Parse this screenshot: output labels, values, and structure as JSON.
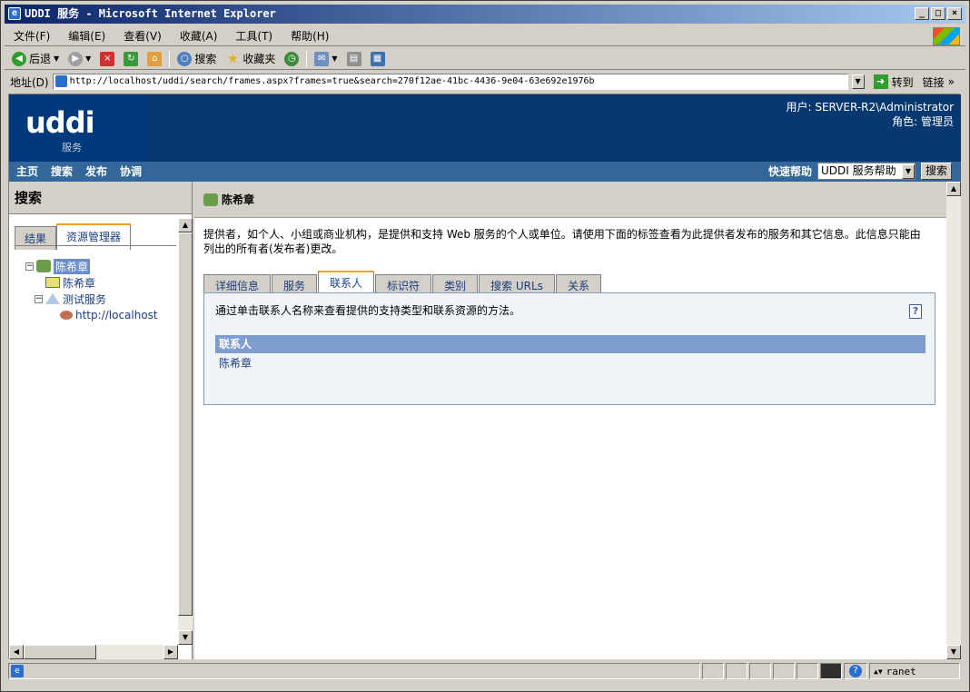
{
  "window": {
    "title": "UDDI 服务 - Microsoft Internet Explorer",
    "min_label": "_",
    "max_label": "□",
    "close_label": "×"
  },
  "menu": [
    "文件(F)",
    "编辑(E)",
    "查看(V)",
    "收藏(A)",
    "工具(T)",
    "帮助(H)"
  ],
  "toolbar": {
    "back_label": "后退",
    "search_label": "搜索",
    "favorites_label": "收藏夹"
  },
  "address": {
    "label": "地址(D)",
    "url": "http://localhost/uddi/search/frames.aspx?frames=true&search=270f12ae-41bc-4436-9e04-63e692e1976b",
    "go_label": "转到",
    "links_label": "链接"
  },
  "header": {
    "logo_main": "uddi",
    "logo_sub": "服务",
    "user_line": "用户: SERVER-R2\\Administrator",
    "role_line": "角色: 管理员"
  },
  "nav": {
    "items": [
      "主页",
      "搜索",
      "发布",
      "协调"
    ],
    "quick_help_label": "快速帮助",
    "quick_help_value": "UDDI 服务帮助",
    "search_button": "搜索"
  },
  "left": {
    "title": "搜索",
    "tabs": [
      "结果",
      "资源管理器"
    ],
    "tree": {
      "root": "陈希章",
      "child1": "陈希章",
      "child2": "测试服务",
      "child2_leaf": "http://localhost"
    }
  },
  "right": {
    "title": "陈希章",
    "description": "提供者，如个人、小组或商业机构，是提供和支持 Web 服务的个人或单位。请使用下面的标签查看为此提供者发布的服务和其它信息。此信息只能由列出的所有者(发布者)更改。",
    "tabs": [
      "详细信息",
      "服务",
      "联系人",
      "标识符",
      "类别",
      "搜索 URLs",
      "关系"
    ],
    "active_tab": "联系人",
    "panel_description": "通过单击联系人名称来查看提供的支持类型和联系资源的方法。",
    "help_icon_glyph": "?",
    "table_header": "联系人",
    "contacts": [
      "陈希章"
    ]
  },
  "status": {
    "zone_text": "ranet"
  }
}
